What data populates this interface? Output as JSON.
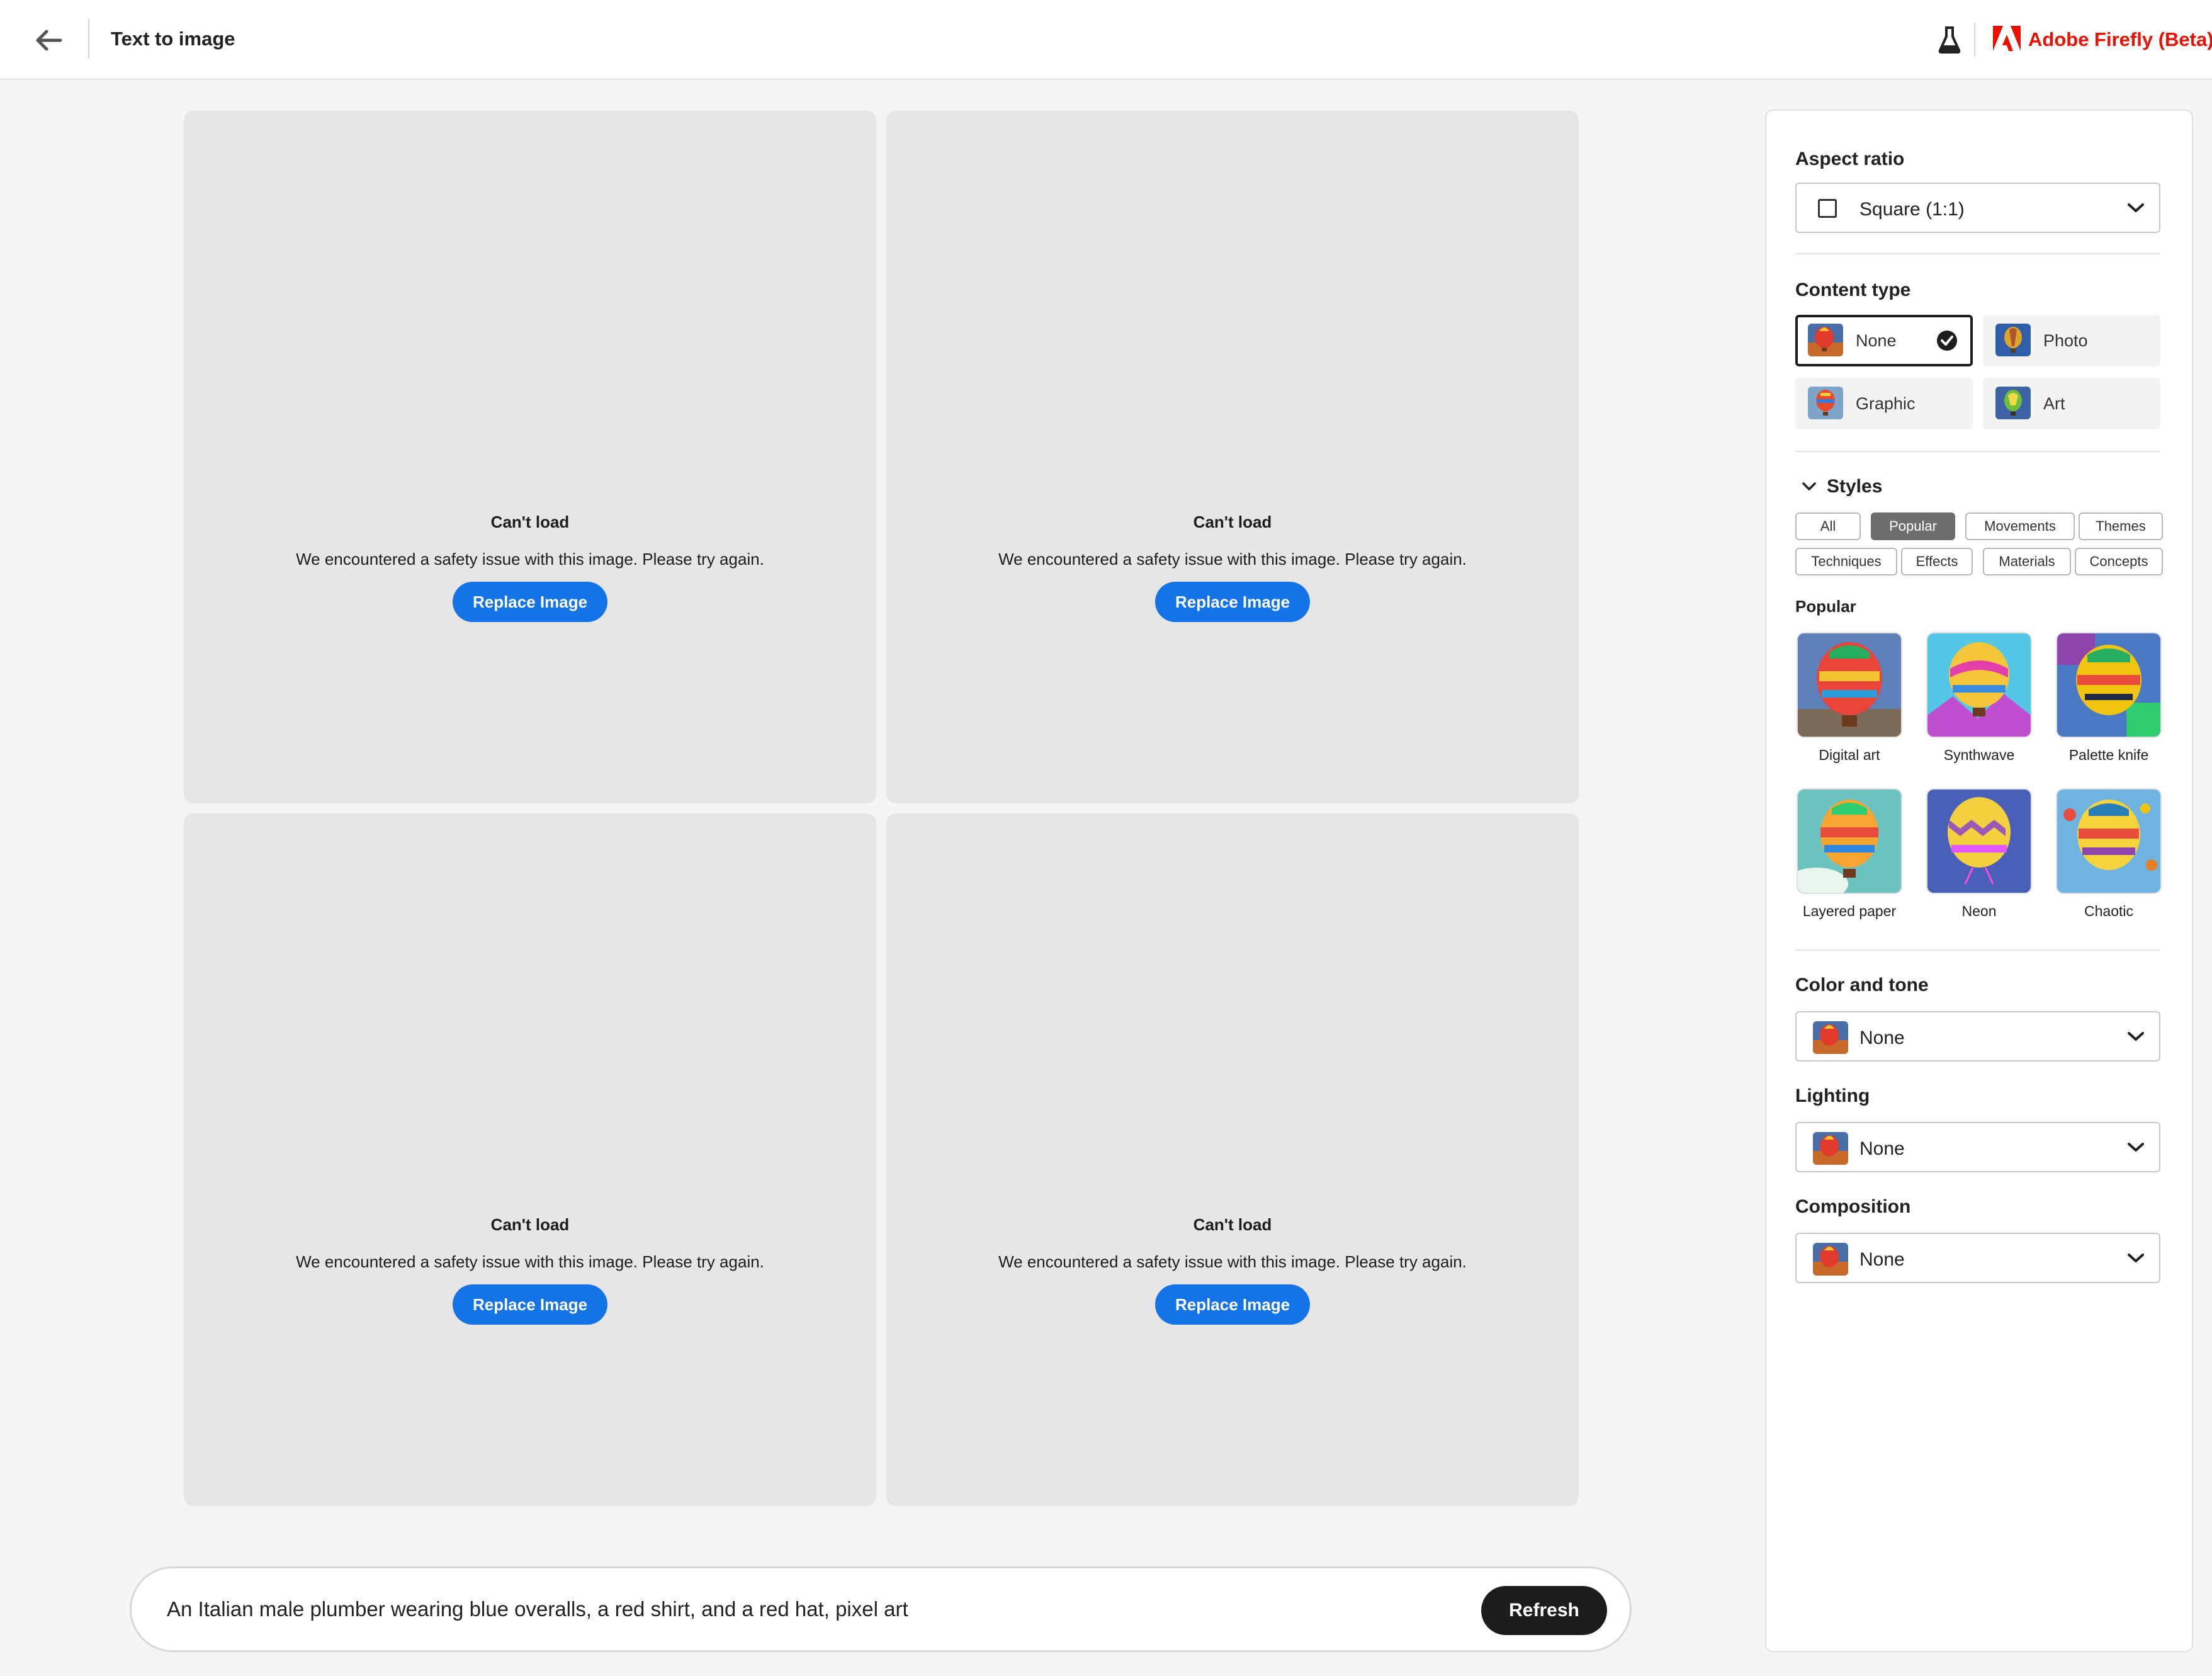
{
  "header": {
    "title": "Text to image",
    "brand": "Adobe Firefly (Beta)"
  },
  "tiles": [
    {
      "title": "Can't load",
      "message": "We encountered a safety issue with this image. Please try again.",
      "button": "Replace Image"
    },
    {
      "title": "Can't load",
      "message": "We encountered a safety issue with this image. Please try again.",
      "button": "Replace Image"
    },
    {
      "title": "Can't load",
      "message": "We encountered a safety issue with this image. Please try again.",
      "button": "Replace Image"
    },
    {
      "title": "Can't load",
      "message": "We encountered a safety issue with this image. Please try again.",
      "button": "Replace Image"
    }
  ],
  "prompt": {
    "text": "An Italian male plumber wearing blue overalls, a red shirt, and a red hat, pixel art",
    "refresh_label": "Refresh"
  },
  "panel": {
    "aspect_ratio": {
      "label": "Aspect ratio",
      "value": "Square (1:1)"
    },
    "content_type": {
      "label": "Content type",
      "options": [
        {
          "label": "None",
          "selected": true
        },
        {
          "label": "Photo",
          "selected": false
        },
        {
          "label": "Graphic",
          "selected": false
        },
        {
          "label": "Art",
          "selected": false
        }
      ]
    },
    "styles": {
      "label": "Styles",
      "chips": [
        "All",
        "Popular",
        "Movements",
        "Themes",
        "Techniques",
        "Effects",
        "Materials",
        "Concepts"
      ],
      "active_chip": "Popular",
      "section_label": "Popular",
      "items": [
        "Digital art",
        "Synthwave",
        "Palette knife",
        "Layered paper",
        "Neon",
        "Chaotic"
      ]
    },
    "color_tone": {
      "label": "Color and tone",
      "value": "None"
    },
    "lighting": {
      "label": "Lighting",
      "value": "None"
    },
    "composition": {
      "label": "Composition",
      "value": "None"
    }
  },
  "colors": {
    "accent": "#1473e6",
    "brand": "#eb1000",
    "dark_button": "#1d1d1d",
    "tile_bg": "#e6e6e6"
  }
}
